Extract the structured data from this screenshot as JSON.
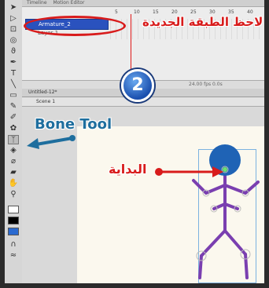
{
  "timeline": {
    "tabs": [
      "Timeline",
      "Motion Editor"
    ],
    "ruler": [
      "5",
      "10",
      "15",
      "20",
      "25",
      "30",
      "35",
      "40"
    ],
    "layers": [
      {
        "name": "Armature_2"
      },
      {
        "name": "Layer 1"
      }
    ],
    "footer_text": "24.00 fps  0.0s"
  },
  "document": {
    "tab_label": "Untitled-12*",
    "scene_label": "Scene 1"
  },
  "annotations": {
    "new_layer_note": "لاحظ الطبقة الجديدة",
    "step_number": "2",
    "bone_tool_label": "Bone Tool",
    "start_label": "البداية"
  },
  "colors": {
    "annotation_red": "#d81b1b",
    "annotation_blue": "#1e6e9e",
    "bone_purple": "#7a3fb0",
    "head_blue": "#1f63b5",
    "layer_highlight": "#2a52be"
  },
  "icons": {
    "tools": [
      "selection-arrow-icon",
      "subselection-icon",
      "free-transform-icon",
      "3d-rotation-icon",
      "lasso-icon",
      "pen-icon",
      "text-icon",
      "line-icon",
      "rectangle-icon",
      "pencil-icon",
      "brush-icon",
      "deco-icon",
      "bone-tool-icon",
      "paint-bucket-icon",
      "eyedropper-icon",
      "eraser-icon",
      "hand-icon",
      "zoom-icon"
    ]
  }
}
